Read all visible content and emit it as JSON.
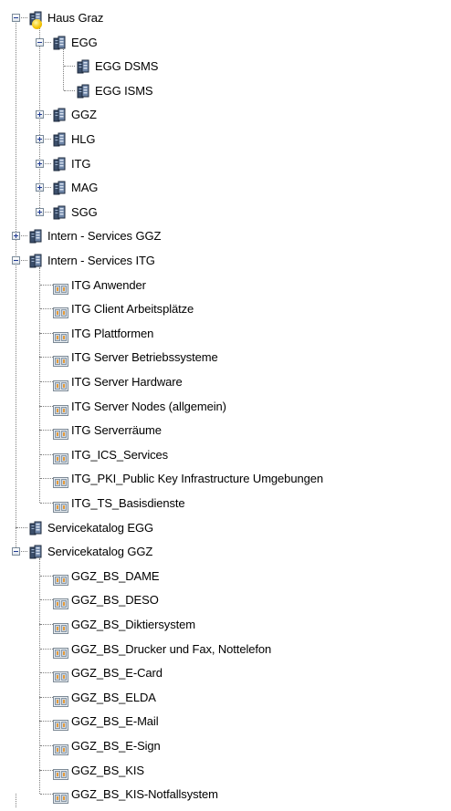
{
  "tree": {
    "nodes": [
      {
        "label": "Haus Graz",
        "level": 0,
        "icon": "server-stack-icon",
        "expander": "minus",
        "selected": true
      },
      {
        "label": "EGG",
        "level": 1,
        "icon": "server-stack-icon",
        "expander": "minus"
      },
      {
        "label": "EGG DSMS",
        "level": 2,
        "icon": "server-stack-icon",
        "expander": "none"
      },
      {
        "label": "EGG ISMS",
        "level": 2,
        "icon": "server-stack-icon",
        "expander": "none"
      },
      {
        "label": "GGZ",
        "level": 1,
        "icon": "server-stack-icon",
        "expander": "plus"
      },
      {
        "label": "HLG",
        "level": 1,
        "icon": "server-stack-icon",
        "expander": "plus"
      },
      {
        "label": "ITG",
        "level": 1,
        "icon": "server-stack-icon",
        "expander": "plus"
      },
      {
        "label": "MAG",
        "level": 1,
        "icon": "server-stack-icon",
        "expander": "plus"
      },
      {
        "label": "SGG",
        "level": 1,
        "icon": "server-stack-icon",
        "expander": "plus"
      },
      {
        "label": "Intern - Services GGZ",
        "level": 0,
        "icon": "server-stack-icon",
        "expander": "plus"
      },
      {
        "label": "Intern - Services ITG",
        "level": 0,
        "icon": "server-stack-icon",
        "expander": "minus"
      },
      {
        "label": "ITG Anwender",
        "level": 1,
        "icon": "service-item-icon",
        "expander": "none"
      },
      {
        "label": "ITG Client Arbeitsplätze",
        "level": 1,
        "icon": "service-item-icon",
        "expander": "none"
      },
      {
        "label": "ITG Plattformen",
        "level": 1,
        "icon": "service-item-icon",
        "expander": "none"
      },
      {
        "label": "ITG Server Betriebssysteme",
        "level": 1,
        "icon": "service-item-icon",
        "expander": "none"
      },
      {
        "label": "ITG Server Hardware",
        "level": 1,
        "icon": "service-item-icon",
        "expander": "none"
      },
      {
        "label": "ITG Server Nodes (allgemein)",
        "level": 1,
        "icon": "service-item-icon",
        "expander": "none"
      },
      {
        "label": "ITG Serverräume",
        "level": 1,
        "icon": "service-item-icon",
        "expander": "none"
      },
      {
        "label": "ITG_ICS_Services",
        "level": 1,
        "icon": "service-item-icon",
        "expander": "none"
      },
      {
        "label": "ITG_PKI_Public Key Infrastructure Umgebungen",
        "level": 1,
        "icon": "service-item-icon",
        "expander": "none"
      },
      {
        "label": "ITG_TS_Basisdienste",
        "level": 1,
        "icon": "service-item-icon",
        "expander": "none"
      },
      {
        "label": "Servicekatalog EGG",
        "level": 0,
        "icon": "server-stack-icon",
        "expander": "none"
      },
      {
        "label": "Servicekatalog GGZ",
        "level": 0,
        "icon": "server-stack-icon",
        "expander": "minus"
      },
      {
        "label": "GGZ_BS_DAME",
        "level": 1,
        "icon": "service-item-icon",
        "expander": "none"
      },
      {
        "label": "GGZ_BS_DESO",
        "level": 1,
        "icon": "service-item-icon",
        "expander": "none"
      },
      {
        "label": "GGZ_BS_Diktiersystem",
        "level": 1,
        "icon": "service-item-icon",
        "expander": "none"
      },
      {
        "label": "GGZ_BS_Drucker und Fax, Nottelefon",
        "level": 1,
        "icon": "service-item-icon",
        "expander": "none"
      },
      {
        "label": "GGZ_BS_E-Card",
        "level": 1,
        "icon": "service-item-icon",
        "expander": "none"
      },
      {
        "label": "GGZ_BS_ELDA",
        "level": 1,
        "icon": "service-item-icon",
        "expander": "none"
      },
      {
        "label": "GGZ_BS_E-Mail",
        "level": 1,
        "icon": "service-item-icon",
        "expander": "none"
      },
      {
        "label": "GGZ_BS_E-Sign",
        "level": 1,
        "icon": "service-item-icon",
        "expander": "none"
      },
      {
        "label": "GGZ_BS_KIS",
        "level": 1,
        "icon": "service-item-icon",
        "expander": "none"
      },
      {
        "label": "GGZ_BS_KIS-Notfallsystem",
        "level": 1,
        "icon": "service-item-icon",
        "expander": "none"
      }
    ]
  },
  "colors": {
    "tree_line": "#808080",
    "expander_border": "#7a8a99",
    "selection_marker": "#f2c200"
  }
}
